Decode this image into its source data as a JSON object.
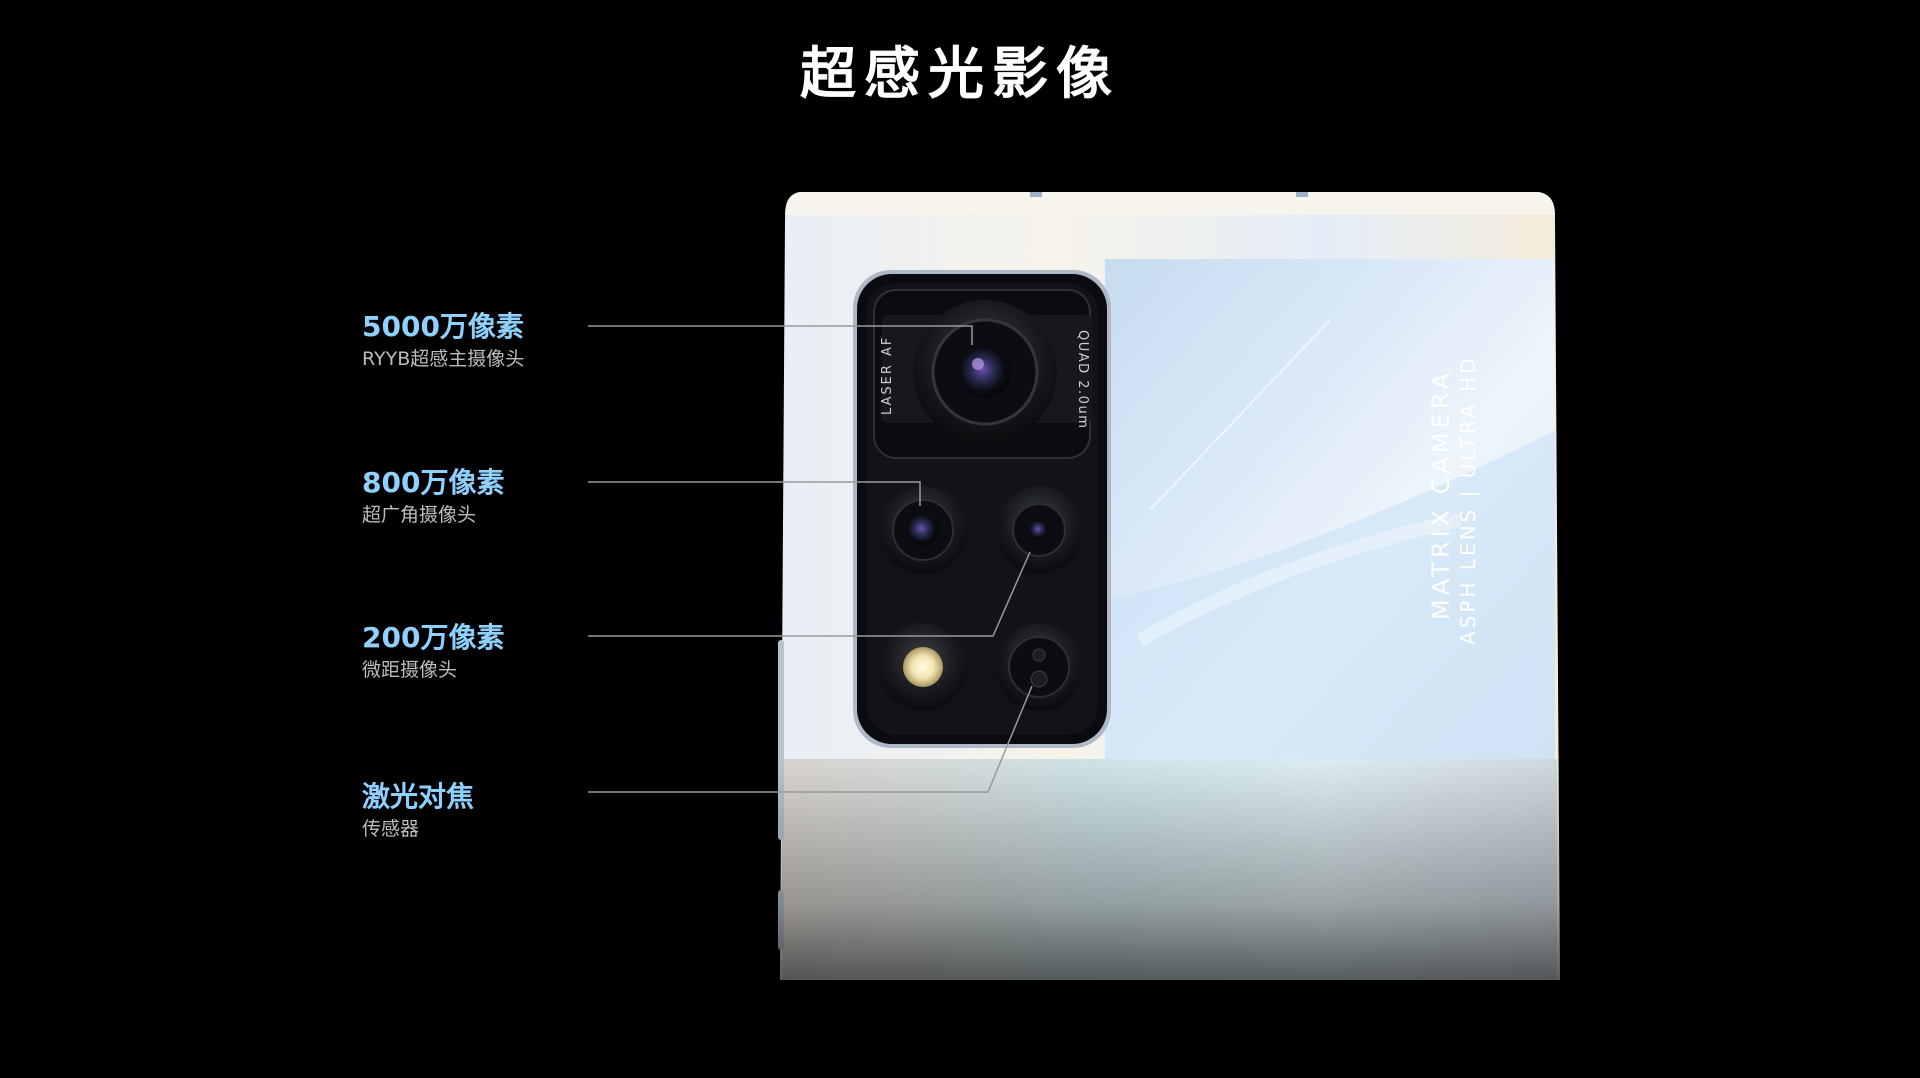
{
  "page": {
    "title": "超感光影像"
  },
  "camera_labels": [
    {
      "title": "5000万像素",
      "subtitle": "RYYB超感主摄像头"
    },
    {
      "title": "800万像素",
      "subtitle": "超广角摄像头"
    },
    {
      "title": "200万像素",
      "subtitle": "微距摄像头"
    },
    {
      "title": "激光对焦",
      "subtitle": "传感器"
    }
  ],
  "module_text": {
    "laser": "LASER",
    "af": "AF",
    "quad": "QUAD 2.0um"
  },
  "back_text": {
    "line1": "MATRIX CAMERA",
    "line2": "ASPH LENS  |  ULTRA HD"
  },
  "colors": {
    "background": "#000000",
    "title": "#ffffff",
    "label_accent": "#8ed1ff",
    "label_sub": "#bdbdbd",
    "leader_line": "#9a9a9a"
  }
}
